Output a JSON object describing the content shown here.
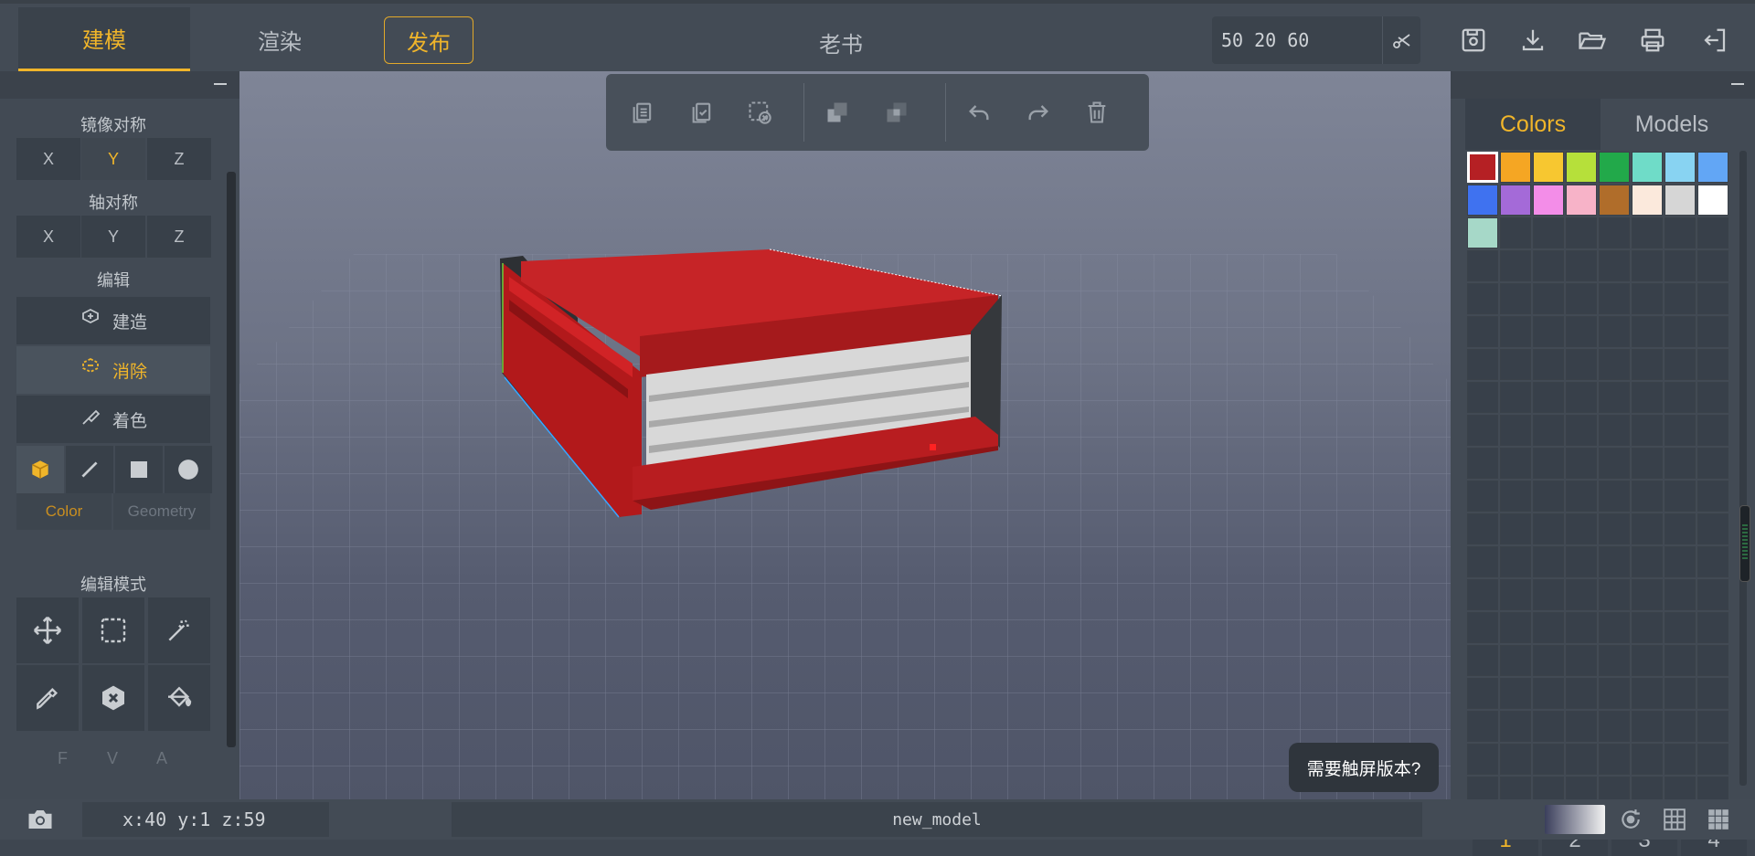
{
  "header": {
    "tabs": [
      {
        "label": "建模",
        "active": true
      },
      {
        "label": "渲染",
        "active": false
      },
      {
        "label": "发布",
        "active": false
      }
    ],
    "title": "老书",
    "dimensions_value": "50 20 60",
    "icons": [
      "scissors-icon",
      "save-icon",
      "download-icon",
      "folder-open-icon",
      "print-icon",
      "logout-icon"
    ]
  },
  "left_panel": {
    "mirror_title": "镜像对称",
    "mirror_axes": [
      "X",
      "Y",
      "Z"
    ],
    "mirror_active": "Y",
    "axis_title": "轴对称",
    "axis_axes": [
      "X",
      "Y",
      "Z"
    ],
    "edit_title": "编辑",
    "edit_buttons": [
      {
        "label": "建造",
        "icon": "build-icon",
        "active": false
      },
      {
        "label": "消除",
        "icon": "erase-icon",
        "active": true
      },
      {
        "label": "着色",
        "icon": "paint-icon",
        "active": false
      }
    ],
    "shape_icons": [
      "cube-icon",
      "line-icon",
      "square-icon",
      "circle-icon"
    ],
    "shape_tabs": [
      "Color",
      "Geometry"
    ],
    "edit_mode_title": "编辑模式",
    "tools": [
      "move-icon",
      "select-box-icon",
      "magic-wand-icon",
      "eyedropper-icon",
      "remove-color-icon",
      "fill-bucket-icon"
    ],
    "fva": [
      "F",
      "V",
      "A"
    ]
  },
  "floating_toolbar": {
    "icons": [
      "copy-icon",
      "paste-icon",
      "clear-selection-icon",
      "union-icon",
      "subtract-icon",
      "undo-icon",
      "redo-icon",
      "delete-icon"
    ]
  },
  "toast": "需要触屏版本?",
  "right_panel": {
    "tabs": [
      {
        "label": "Colors",
        "active": true
      },
      {
        "label": "Models",
        "active": false
      }
    ],
    "palette": [
      "#b52024",
      "#f5a623",
      "#f7c730",
      "#b6e03a",
      "#22a94a",
      "#6fdcc8",
      "#88d3f2",
      "#62a6f5",
      "#3f72f0",
      "#a46ad8",
      "#f38de8",
      "#f7b3c8",
      "#b06d2a",
      "#fbe9dc",
      "#d6d6d6",
      "#ffffff",
      "#a6d8c8"
    ],
    "pages": [
      "1",
      "2",
      "3",
      "4"
    ],
    "active_page": "1"
  },
  "bottom_bar": {
    "coords": "x:40  y:1  z:59",
    "model_name": "new_model",
    "icons": [
      "camera-icon",
      "gradient-icon",
      "reset-view-icon",
      "grid-icon",
      "grid-dense-icon"
    ]
  }
}
